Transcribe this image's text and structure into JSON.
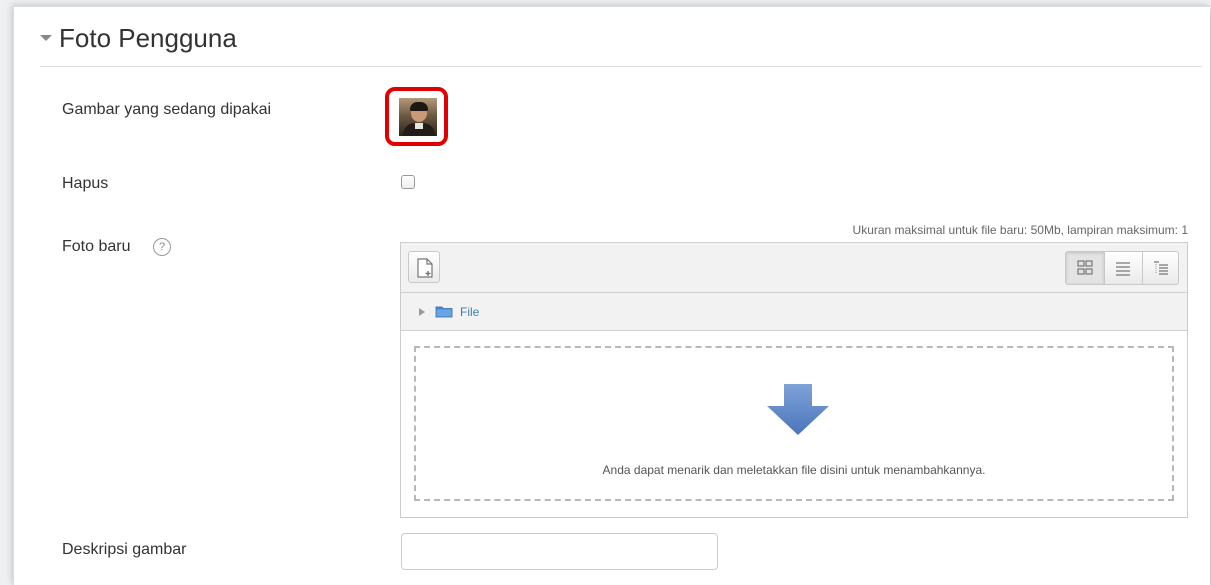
{
  "section": {
    "title": "Foto Pengguna",
    "icon": "collapse-caret-icon"
  },
  "fields": {
    "current_picture_label": "Gambar yang sedang dipakai",
    "delete_label": "Hapus",
    "delete_checked": false,
    "new_picture_label": "Foto baru",
    "help_icon": "?",
    "description_label": "Deskripsi gambar",
    "description_value": ""
  },
  "filepicker": {
    "limits": "Ukuran maksimal untuk file baru: 50Mb, lampiran maksimum: 1",
    "path_label": "File",
    "drop_text": "Anda dapat menarik dan meletakkan file disini untuk menambahkannya.",
    "view_modes": [
      "icons",
      "details",
      "tree"
    ],
    "active_view": "icons"
  },
  "colors": {
    "highlight": "#e00000",
    "drop_arrow": "#5b84c4",
    "link": "#3a7fb0"
  }
}
